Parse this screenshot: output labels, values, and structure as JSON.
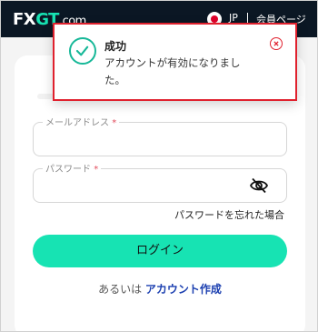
{
  "header": {
    "logo_fx": "FX",
    "logo_gt": "GT",
    "logo_com": ".com",
    "language": "JP",
    "member_page": "会員ページ"
  },
  "login_form": {
    "email_label": "メールアドレス",
    "password_label": "パスワード",
    "required_mark": "*",
    "forgot_password": "パスワードを忘れた場合",
    "login_button": "ログイン",
    "alt_prefix": "あるいは",
    "create_account": "アカウント作成"
  },
  "toast": {
    "title": "成功",
    "message": "アカウントが有効になりました。",
    "status_color": "#17b898",
    "border_color": "#e0212e"
  },
  "colors": {
    "header_bg": "#0b1724",
    "accent": "#17e3b3",
    "link": "#1b3fb0"
  }
}
